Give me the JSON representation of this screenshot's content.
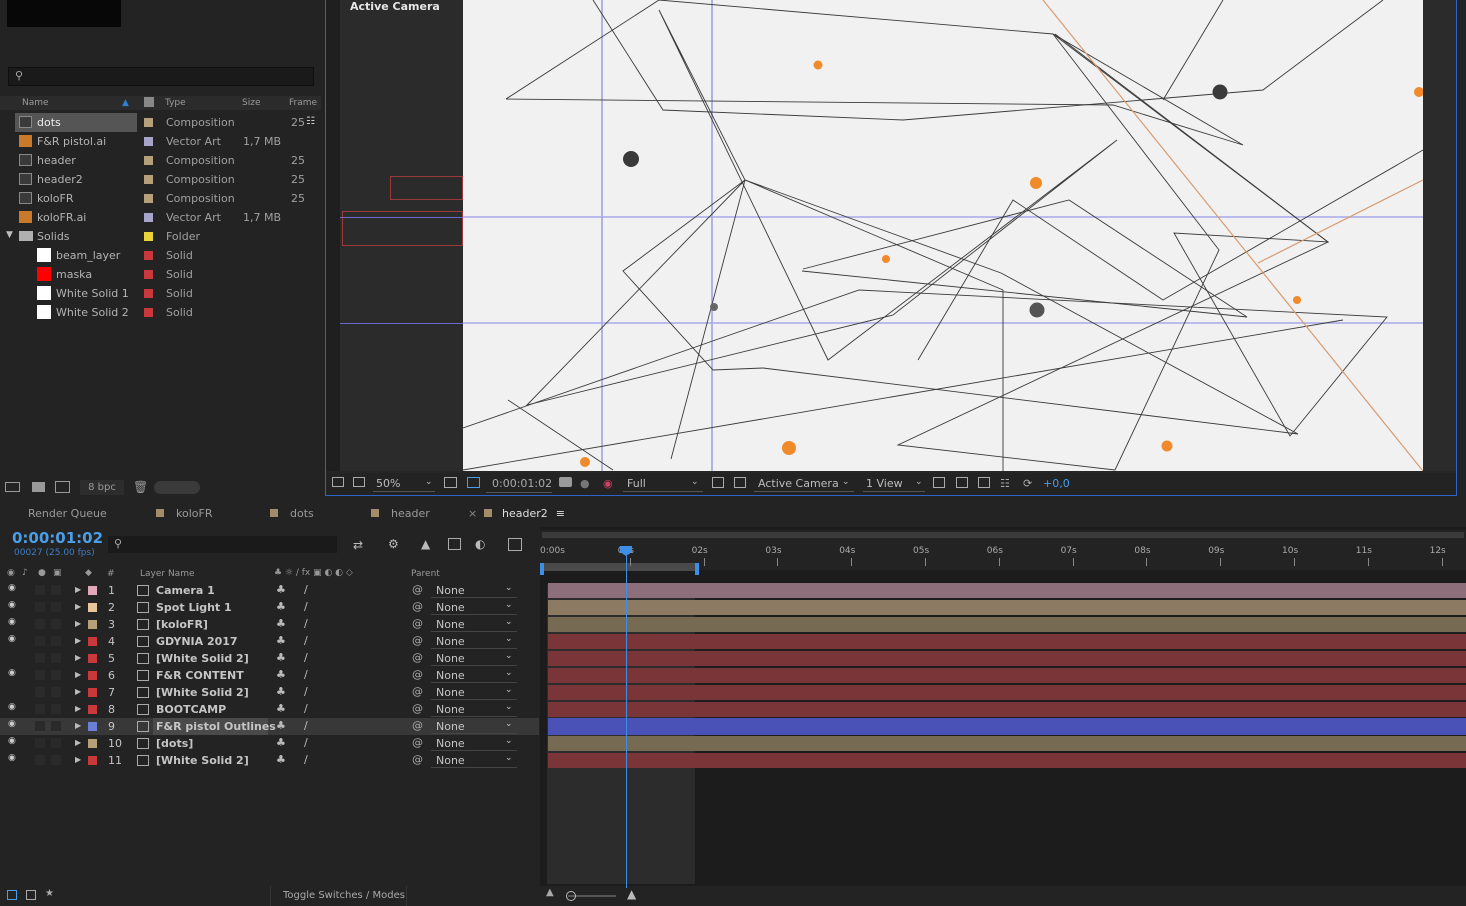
{
  "project": {
    "search_placeholder": "",
    "columns": {
      "name": "Name",
      "type": "Type",
      "size": "Size",
      "frame": "Frame"
    },
    "items": [
      {
        "name": "dots",
        "type": "Composition",
        "size": "",
        "frame": "25",
        "label_color": "#b5a07a",
        "selected": true
      },
      {
        "name": "F&R pistol.ai",
        "type": "Vector Art",
        "size": "1,7 MB",
        "frame": "",
        "label_color": "#a6a5c9"
      },
      {
        "name": "header",
        "type": "Composition",
        "size": "",
        "frame": "25",
        "label_color": "#b5a07a"
      },
      {
        "name": "header2",
        "type": "Composition",
        "size": "",
        "frame": "25",
        "label_color": "#b5a07a"
      },
      {
        "name": "koloFR",
        "type": "Composition",
        "size": "",
        "frame": "25",
        "label_color": "#b5a07a"
      },
      {
        "name": "koloFR.ai",
        "type": "Vector Art",
        "size": "1,7 MB",
        "frame": "",
        "label_color": "#a6a5c9"
      },
      {
        "name": "Solids",
        "type": "Folder",
        "size": "",
        "frame": "",
        "label_color": "#e8d43a"
      },
      {
        "name": "beam_layer",
        "type": "Solid",
        "size": "",
        "frame": "",
        "label_color": "#c9393b",
        "swatch": "#ffffff"
      },
      {
        "name": "maska",
        "type": "Solid",
        "size": "",
        "frame": "",
        "label_color": "#c9393b",
        "swatch": "#ff0000"
      },
      {
        "name": "White Solid 1",
        "type": "Solid",
        "size": "",
        "frame": "",
        "label_color": "#c9393b",
        "swatch": "#ffffff"
      },
      {
        "name": "White Solid 2",
        "type": "Solid",
        "size": "",
        "frame": "",
        "label_color": "#c9393b",
        "swatch": "#ffffff"
      }
    ],
    "bpc": "8 bpc"
  },
  "viewer": {
    "camera_label": "Active Camera",
    "zoom": "50%",
    "time": "0:00:01:02",
    "resolution": "Full",
    "view_camera": "Active Camera",
    "views": "1 View",
    "exposure": "+0,0"
  },
  "timeline": {
    "tabs": [
      "Render Queue",
      "koloFR",
      "dots",
      "header",
      "header2"
    ],
    "active_tab": "header2",
    "timecode": "0:00:01:02",
    "frame_info": "00027 (25.00 fps)",
    "header": {
      "num": "#",
      "layer_name": "Layer Name",
      "parent": "Parent"
    },
    "ruler": [
      "0:00s",
      "01s",
      "02s",
      "03s",
      "04s",
      "05s",
      "06s",
      "07s",
      "08s",
      "09s",
      "10s",
      "11s",
      "12s"
    ],
    "layers": [
      {
        "num": "1",
        "name": "Camera 1",
        "color": "#e0a8b8",
        "parent": "None",
        "bar": "#8c6f7a"
      },
      {
        "num": "2",
        "name": "Spot Light 1",
        "color": "#e8c49a",
        "parent": "None",
        "bar": "#8c7a62"
      },
      {
        "num": "3",
        "name": "[koloFR]",
        "color": "#b5a07a",
        "parent": "None",
        "bar": "#766a53"
      },
      {
        "num": "4",
        "name": "GDYNIA 2017",
        "color": "#c9393b",
        "parent": "None",
        "bar": "#7a3538"
      },
      {
        "num": "5",
        "name": "[White Solid 2]",
        "color": "#c9393b",
        "parent": "None",
        "bar": "#7a3538"
      },
      {
        "num": "6",
        "name": "F&R CONTENT",
        "color": "#c9393b",
        "parent": "None",
        "bar": "#7a3538"
      },
      {
        "num": "7",
        "name": "[White Solid 2]",
        "color": "#c9393b",
        "parent": "None",
        "bar": "#7a3538"
      },
      {
        "num": "8",
        "name": "BOOTCAMP",
        "color": "#c9393b",
        "parent": "None",
        "bar": "#7a3538"
      },
      {
        "num": "9",
        "name": "F&R pistol Outlines",
        "color": "#6b7fd8",
        "parent": "None",
        "bar": "#4a52b8",
        "selected": true
      },
      {
        "num": "10",
        "name": "[dots]",
        "color": "#b5a07a",
        "parent": "None",
        "bar": "#766a53"
      },
      {
        "num": "11",
        "name": "[White Solid 2]",
        "color": "#c9393b",
        "parent": "None",
        "bar": "#7a3538"
      }
    ],
    "footer": "Toggle Switches / Modes"
  }
}
